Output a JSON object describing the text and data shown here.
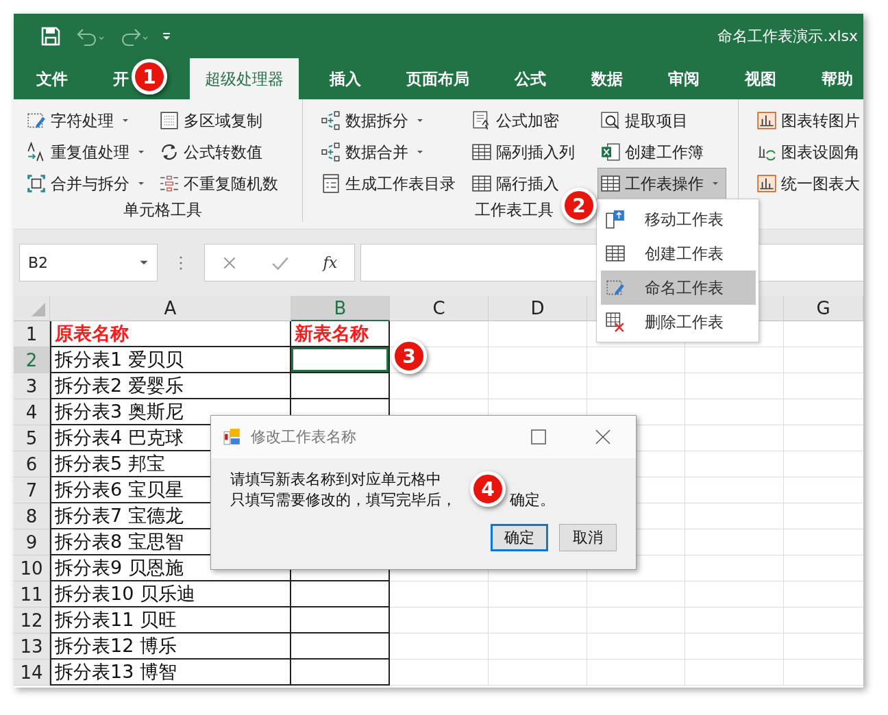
{
  "window": {
    "title": "命名工作表演示.xlsx"
  },
  "tabs": [
    {
      "label": "文件",
      "selected": false
    },
    {
      "label": "开",
      "selected": false
    },
    {
      "label": "超级处理器",
      "selected": true
    },
    {
      "label": "插入",
      "selected": false
    },
    {
      "label": "页面布局",
      "selected": false
    },
    {
      "label": "公式",
      "selected": false
    },
    {
      "label": "数据",
      "selected": false
    },
    {
      "label": "审阅",
      "selected": false
    },
    {
      "label": "视图",
      "selected": false
    },
    {
      "label": "帮助",
      "selected": false
    }
  ],
  "ribbon": {
    "groups": [
      {
        "label": "单元格工具",
        "columns": [
          [
            {
              "label": "字符处理",
              "dropdown": true,
              "pressed": false
            },
            {
              "label": "重复值处理",
              "dropdown": true,
              "pressed": false
            },
            {
              "label": "合并与拆分",
              "dropdown": true,
              "pressed": false
            }
          ],
          [
            {
              "label": "多区域复制",
              "dropdown": false,
              "pressed": false
            },
            {
              "label": "公式转数值",
              "dropdown": false,
              "pressed": false
            },
            {
              "label": "不重复随机数",
              "dropdown": false,
              "pressed": false
            }
          ]
        ]
      },
      {
        "label": "工作表工具",
        "columns": [
          [
            {
              "label": "数据拆分",
              "dropdown": true,
              "pressed": false
            },
            {
              "label": "数据合并",
              "dropdown": true,
              "pressed": false
            },
            {
              "label": "生成工作表目录",
              "dropdown": false,
              "pressed": false
            }
          ],
          [
            {
              "label": "公式加密",
              "dropdown": false,
              "pressed": false
            },
            {
              "label": "隔列插入列",
              "dropdown": false,
              "pressed": false
            },
            {
              "label": "隔行插入",
              "dropdown": false,
              "pressed": false
            }
          ],
          [
            {
              "label": "提取项目",
              "dropdown": false,
              "pressed": false
            },
            {
              "label": "创建工作簿",
              "dropdown": false,
              "pressed": false
            },
            {
              "label": "工作表操作",
              "dropdown": true,
              "pressed": true
            }
          ]
        ]
      },
      {
        "columns": [
          [
            {
              "label": "图表转图片",
              "dropdown": false,
              "pressed": false
            },
            {
              "label": "图表设圆角",
              "dropdown": false,
              "pressed": false
            },
            {
              "label": "统一图表大",
              "dropdown": false,
              "pressed": false
            }
          ]
        ]
      }
    ]
  },
  "formula_bar": {
    "name_box": "B2",
    "function_button": "fx"
  },
  "sheet": {
    "columns": [
      {
        "label": "A",
        "selected": false
      },
      {
        "label": "B",
        "selected": true
      },
      {
        "label": "C",
        "selected": false
      },
      {
        "label": "D",
        "selected": false
      },
      {
        "selected": false
      },
      {
        "selected": false
      },
      {
        "label": "G",
        "selected": false
      }
    ],
    "rows": [
      {
        "number": "1",
        "selected": false,
        "kind": "header",
        "cells": [
          "原表名称",
          "新表名称"
        ]
      },
      {
        "number": "2",
        "selected": true,
        "kind": "data",
        "cells": [
          "拆分表1 爱贝贝"
        ]
      },
      {
        "number": "3",
        "selected": false,
        "kind": "data",
        "cells": [
          "拆分表2 爱婴乐"
        ]
      },
      {
        "number": "4",
        "selected": false,
        "kind": "data",
        "cells": [
          "拆分表3 奥斯尼"
        ]
      },
      {
        "number": "5",
        "selected": false,
        "kind": "data",
        "cells": [
          "拆分表4 巴克球"
        ]
      },
      {
        "number": "6",
        "selected": false,
        "kind": "data",
        "cells": [
          "拆分表5 邦宝"
        ]
      },
      {
        "number": "7",
        "selected": false,
        "kind": "data",
        "cells": [
          "拆分表6 宝贝星"
        ]
      },
      {
        "number": "8",
        "selected": false,
        "kind": "data",
        "cells": [
          "拆分表7 宝德龙"
        ]
      },
      {
        "number": "9",
        "selected": false,
        "kind": "data",
        "cells": [
          "拆分表8 宝思智"
        ]
      },
      {
        "number": "10",
        "selected": false,
        "kind": "data",
        "cells": [
          "拆分表9 贝恩施"
        ]
      },
      {
        "number": "11",
        "selected": false,
        "kind": "data",
        "cells": [
          "拆分表10 贝乐迪"
        ]
      },
      {
        "number": "12",
        "selected": false,
        "kind": "data",
        "cells": [
          "拆分表11 贝旺"
        ]
      },
      {
        "number": "13",
        "selected": false,
        "kind": "data",
        "cells": [
          "拆分表12 博乐"
        ]
      },
      {
        "number": "14",
        "selected": false,
        "kind": "data",
        "cells": [
          "拆分表13 博智"
        ]
      }
    ]
  },
  "menu": {
    "items": [
      {
        "label": "移动工作表",
        "selected": false
      },
      {
        "label": "创建工作表",
        "selected": false
      },
      {
        "label": "命名工作表",
        "selected": true
      },
      {
        "label": "删除工作表",
        "selected": false
      }
    ]
  },
  "dialog": {
    "title": "修改工作表名称",
    "message": {
      "line_1": "请填写新表名称到对应单元格中",
      "line_2_start": "只填写需要修改的，填写完毕后，",
      "line_2_end": "确定。"
    },
    "buttons": [
      {
        "label": "确定",
        "default": true
      },
      {
        "label": "取消",
        "default": false
      }
    ]
  },
  "callouts": [
    "1",
    "2",
    "3",
    "4"
  ]
}
